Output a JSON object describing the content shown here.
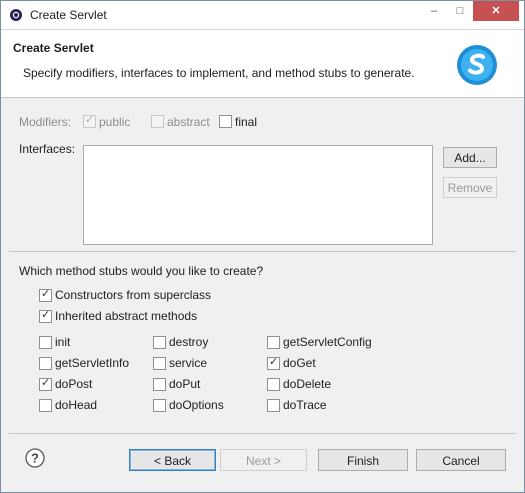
{
  "window": {
    "title": "Create Servlet",
    "min": "–",
    "max": "□",
    "close": "✕"
  },
  "banner": {
    "title": "Create Servlet",
    "description": "Specify modifiers, interfaces to implement, and method stubs to generate."
  },
  "modifiers": {
    "label": "Modifiers:",
    "public": {
      "label": "public",
      "checked": true,
      "enabled": false
    },
    "abstract": {
      "label": "abstract",
      "checked": false,
      "enabled": false
    },
    "final": {
      "label": "final",
      "checked": false,
      "enabled": true
    }
  },
  "interfaces": {
    "label": "Interfaces:",
    "add": "Add...",
    "remove": "Remove"
  },
  "stubs": {
    "question": "Which method stubs would you like to create?",
    "constructors": "Constructors from superclass",
    "inherited": "Inherited abstract methods",
    "methods": [
      {
        "label": "init",
        "checked": false
      },
      {
        "label": "destroy",
        "checked": false
      },
      {
        "label": "getServletConfig",
        "checked": false
      },
      {
        "label": "getServletInfo",
        "checked": false
      },
      {
        "label": "service",
        "checked": false
      },
      {
        "label": "doGet",
        "checked": true
      },
      {
        "label": "doPost",
        "checked": true
      },
      {
        "label": "doPut",
        "checked": false
      },
      {
        "label": "doDelete",
        "checked": false
      },
      {
        "label": "doHead",
        "checked": false
      },
      {
        "label": "doOptions",
        "checked": false
      },
      {
        "label": "doTrace",
        "checked": false
      }
    ]
  },
  "buttons": {
    "back": "< Back",
    "next": "Next >",
    "finish": "Finish",
    "cancel": "Cancel",
    "help": "?"
  }
}
